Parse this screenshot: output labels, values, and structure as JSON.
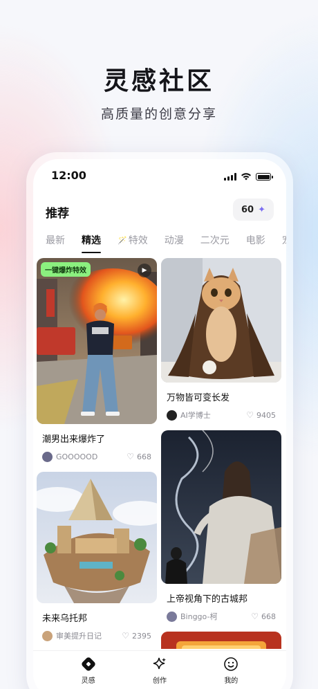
{
  "promo": {
    "title": "灵感社区",
    "subtitle": "高质量的创意分享"
  },
  "status_bar": {
    "time": "12:00"
  },
  "header": {
    "title": "推荐",
    "points_value": "60",
    "points_icon": "sparkle-icon"
  },
  "tabs": [
    {
      "label": "最新",
      "active": false
    },
    {
      "label": "精选",
      "active": true
    },
    {
      "label": "特效",
      "active": false,
      "icon": "magic-wand-icon"
    },
    {
      "label": "动漫",
      "active": false
    },
    {
      "label": "二次元",
      "active": false
    },
    {
      "label": "电影",
      "active": false
    },
    {
      "label": "宠",
      "active": false
    }
  ],
  "feed": {
    "left": [
      {
        "title": "潮男出来爆炸了",
        "author": "GOOOOOD",
        "likes": "668",
        "badge": "一键爆炸特效",
        "has_video": true
      },
      {
        "title": "未来乌托邦",
        "author": "审美提升日记",
        "likes": "2395"
      }
    ],
    "right": [
      {
        "title": "万物皆可变长发",
        "author": "AI学博士",
        "likes": "9405"
      },
      {
        "title": "上帝视角下的古城邦",
        "author": "Binggo-柯",
        "likes": "668"
      }
    ]
  },
  "bottom_nav": [
    {
      "label": "灵感",
      "icon": "inspiration-icon"
    },
    {
      "label": "创作",
      "icon": "create-sparkle-icon"
    },
    {
      "label": "我的",
      "icon": "profile-smile-icon"
    }
  ],
  "colors": {
    "badge_bg": "#8bf07f",
    "accent_purple": "#7a6cf2"
  }
}
